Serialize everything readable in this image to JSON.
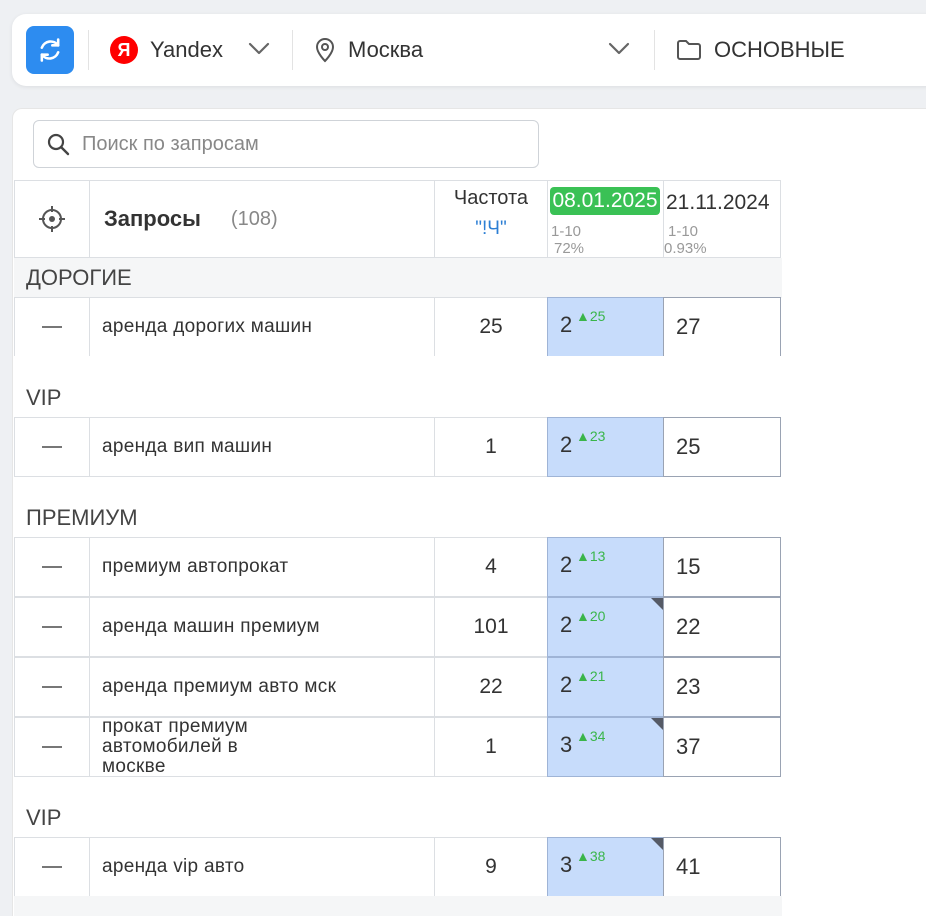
{
  "toolbar": {
    "engine": "Yandex",
    "engine_logo": "Я",
    "region": "Москва",
    "folder": "ОСНОВНЫЕ"
  },
  "search": {
    "placeholder": "Поиск по запросам"
  },
  "header": {
    "queries_label": "Запросы",
    "queries_count": "(108)",
    "freq_label": "Частота",
    "freq_type": "\"!Ч\"",
    "date1": "08.01.2025",
    "date1_range": "1-10",
    "date1_pct": "72%",
    "date2": "21.11.2024",
    "date2_range": "1-10",
    "date2_pct": "0.93%"
  },
  "groups": [
    {
      "name": "ДОРОГИЕ",
      "rows": [
        {
          "query": "аренда дорогих машин",
          "freq": "25",
          "pos": "2",
          "delta": "▲25",
          "flag": false,
          "prev": "27"
        }
      ]
    },
    {
      "name": "VIP",
      "rows": [
        {
          "query": "аренда вип машин",
          "freq": "1",
          "pos": "2",
          "delta": "▲23",
          "flag": false,
          "prev": "25"
        }
      ]
    },
    {
      "name": "ПРЕМИУМ",
      "rows": [
        {
          "query": "премиум автопрокат",
          "freq": "4",
          "pos": "2",
          "delta": "▲13",
          "flag": false,
          "prev": "15"
        },
        {
          "query": "аренда машин премиум",
          "freq": "101",
          "pos": "2",
          "delta": "▲20",
          "flag": true,
          "prev": "22"
        },
        {
          "query": "аренда премиум авто мск",
          "freq": "22",
          "pos": "2",
          "delta": "▲21",
          "flag": false,
          "prev": "23"
        },
        {
          "query": "прокат премиум автомобилей в москве",
          "freq": "1",
          "pos": "3",
          "delta": "▲34",
          "flag": true,
          "prev": "37"
        }
      ]
    },
    {
      "name": "VIP",
      "rows": [
        {
          "query": "аренда vip авто",
          "freq": "9",
          "pos": "3",
          "delta": "▲38",
          "flag": true,
          "prev": "41"
        }
      ]
    }
  ],
  "colors": {
    "accent": "#2d8cf0",
    "date_badge": "#3ac155",
    "pos_bg": "#c7dcfb",
    "up": "#3ab54a"
  },
  "icons": [
    "refresh-icon",
    "yandex-logo",
    "chevron-down-icon",
    "location-pin-icon",
    "folder-icon",
    "search-icon",
    "crosshair-icon",
    "minus-icon"
  ]
}
